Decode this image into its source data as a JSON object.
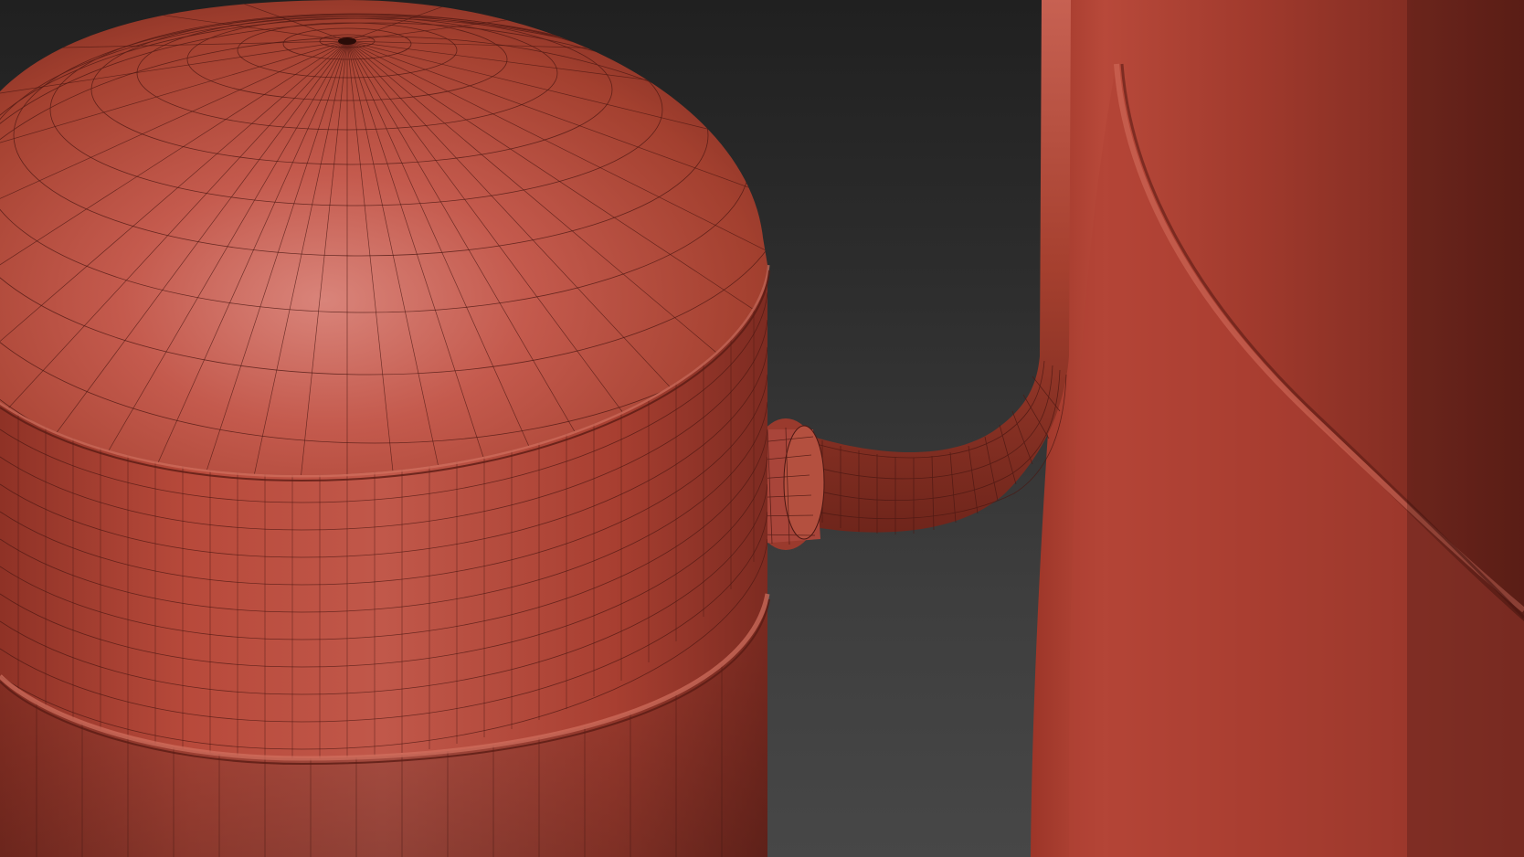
{
  "viewport": {
    "background_top": "#202020",
    "background_bottom": "#474747"
  },
  "scene": {
    "objects": [
      {
        "name": "compressor-tank",
        "color": "#b8473a",
        "wireframe": true
      },
      {
        "name": "connector-pipe",
        "color": "#b0453a",
        "wireframe": true
      },
      {
        "name": "second-tank",
        "color": "#a93f33",
        "wireframe": false
      }
    ],
    "wire_color": "#4a1712"
  }
}
